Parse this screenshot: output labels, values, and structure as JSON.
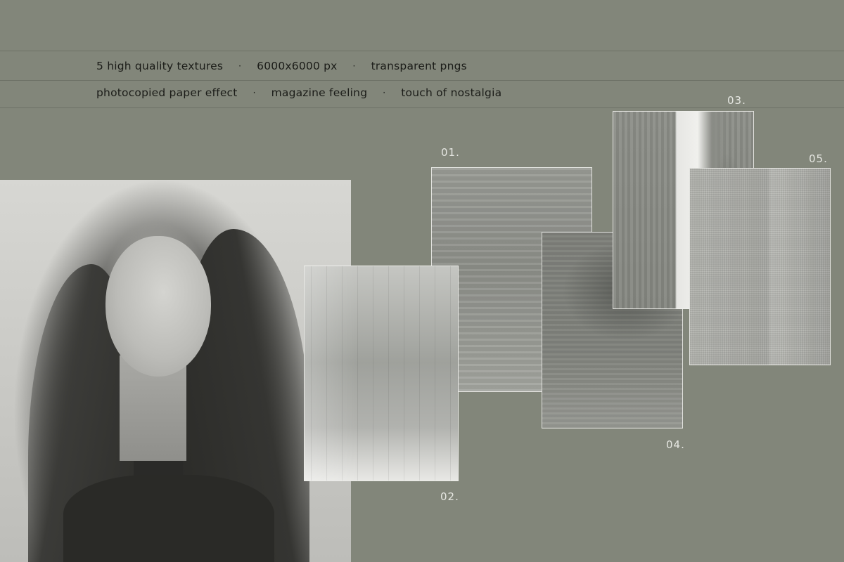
{
  "header": {
    "row1": [
      "5 high quality textures",
      "6000x6000 px",
      "transparent pngs"
    ],
    "row2": [
      "photocopied paper effect",
      "magazine feeling",
      "touch of nostalgia"
    ],
    "separator": "·"
  },
  "textures": {
    "t01": "01.",
    "t02": "02.",
    "t03": "03.",
    "t04": "04.",
    "t05": "05."
  },
  "colors": {
    "background": "#82867a",
    "text": "#1b1c18",
    "label": "#e6e7e2"
  }
}
